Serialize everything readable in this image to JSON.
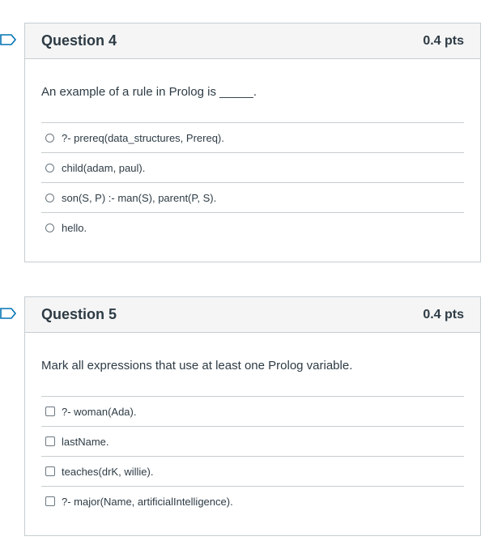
{
  "questions": [
    {
      "title": "Question 4",
      "points": "0.4 pts",
      "prompt": "An example of a rule in Prolog is _____.",
      "input_type": "radio",
      "answers": [
        "?- prereq(data_structures, Prereq).",
        "child(adam, paul).",
        "son(S, P) :- man(S), parent(P, S).",
        "hello."
      ]
    },
    {
      "title": "Question 5",
      "points": "0.4 pts",
      "prompt": "Mark all expressions that use at least one Prolog variable.",
      "input_type": "checkbox",
      "answers": [
        "?- woman(Ada).",
        "lastName.",
        "teaches(drK, willie).",
        "?- major(Name, artificialIntelligence)."
      ]
    }
  ],
  "colors": {
    "accent": "#0374b5",
    "border": "#c7cdd1",
    "header_bg": "#f5f5f5",
    "text": "#2d3b45"
  },
  "icons": {
    "flag": "flag-icon",
    "radio": "radio-icon",
    "checkbox": "checkbox-icon"
  }
}
